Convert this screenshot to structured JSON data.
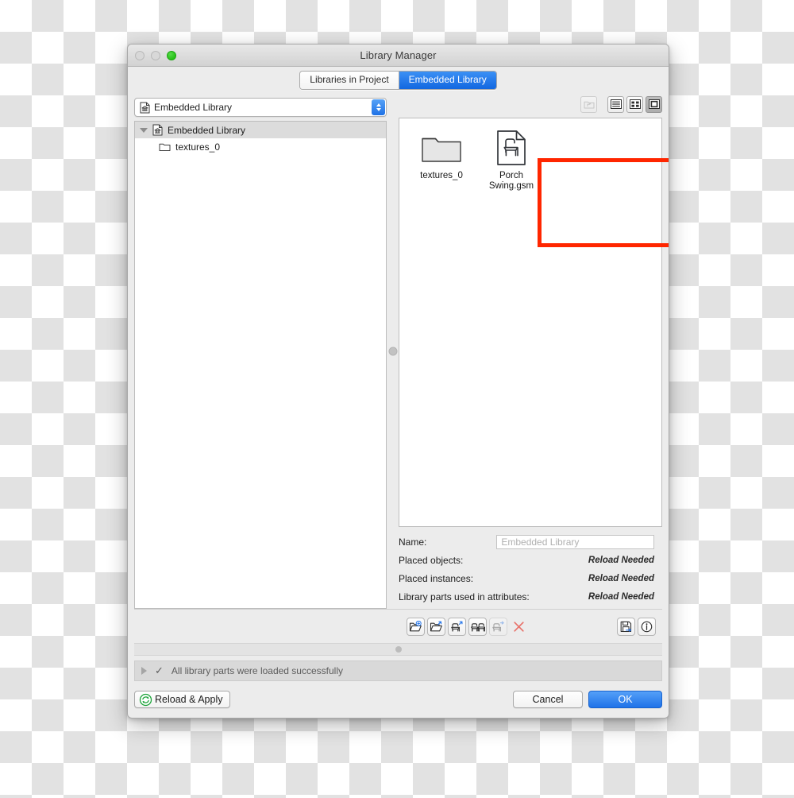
{
  "window": {
    "title": "Library Manager",
    "traffic_lights": [
      "close-button",
      "minimize-button",
      "zoom-button"
    ]
  },
  "tabs": [
    {
      "label": "Libraries in Project",
      "active": false
    },
    {
      "label": "Embedded Library",
      "active": true
    }
  ],
  "library_popup": {
    "value": "Embedded Library",
    "icon": "library-document-icon"
  },
  "tree": {
    "items": [
      {
        "label": "Embedded Library",
        "icon": "library-document-icon",
        "selected": true,
        "expanded": true,
        "depth": 0
      },
      {
        "label": "textures_0",
        "icon": "folder-icon",
        "selected": false,
        "depth": 1
      }
    ]
  },
  "view_toolbar": {
    "buttons": [
      {
        "name": "go-up-folder-button",
        "icon": "folder-up-icon",
        "state": "disabled"
      },
      {
        "name": "list-view-button",
        "icon": "list-view-icon",
        "state": "normal"
      },
      {
        "name": "grid-view-button",
        "icon": "grid-view-icon",
        "state": "normal"
      },
      {
        "name": "large-icon-view-button",
        "icon": "large-icon-view-icon",
        "state": "selected"
      }
    ]
  },
  "content": {
    "items": [
      {
        "label": "textures_0",
        "icon": "folder-icon",
        "type": "folder"
      },
      {
        "label": "Porch Swing.gsm",
        "icon": "library-part-chair-icon",
        "type": "library-part"
      }
    ]
  },
  "annotation": {
    "color": "#FF2600",
    "shape": "rectangle"
  },
  "info_panel": {
    "name_label": "Name:",
    "name_placeholder": "Embedded Library",
    "rows": [
      {
        "label": "Placed objects:",
        "value": "Reload Needed"
      },
      {
        "label": "Placed instances:",
        "value": "Reload Needed"
      },
      {
        "label": "Library parts used in attributes:",
        "value": "Reload Needed"
      }
    ]
  },
  "action_toolbar": {
    "left_buttons": [
      {
        "name": "add-library-folder-button",
        "icon": "folder-plus-icon",
        "state": "normal"
      },
      {
        "name": "open-library-folder-button",
        "icon": "folder-arrow-icon",
        "state": "normal"
      },
      {
        "name": "add-library-part-button",
        "icon": "chair-arrow-icon",
        "state": "normal"
      },
      {
        "name": "duplicate-library-part-button",
        "icon": "chair-duplicate-icon",
        "state": "normal"
      },
      {
        "name": "move-library-part-button",
        "icon": "chair-move-icon",
        "state": "disabled"
      },
      {
        "name": "delete-button",
        "icon": "close-x-icon",
        "state": "normal"
      }
    ],
    "right_buttons": [
      {
        "name": "save-library-button",
        "icon": "floppy-save-icon",
        "state": "normal"
      },
      {
        "name": "info-button",
        "icon": "info-circle-icon",
        "state": "normal"
      }
    ]
  },
  "status_bar": {
    "message": "All library parts were loaded successfully",
    "disclosure_icon": "triangle-right-icon",
    "state_icon": "checkmark-icon"
  },
  "footer": {
    "reload_label": "Reload & Apply",
    "reload_icon": "reload-circular-arrows-icon",
    "cancel_label": "Cancel",
    "ok_label": "OK"
  },
  "colors": {
    "accent_blue": "#1f72e6",
    "annotation_red": "#FF2600",
    "reload_green": "#19a337",
    "delete_red": "#e8726a"
  }
}
